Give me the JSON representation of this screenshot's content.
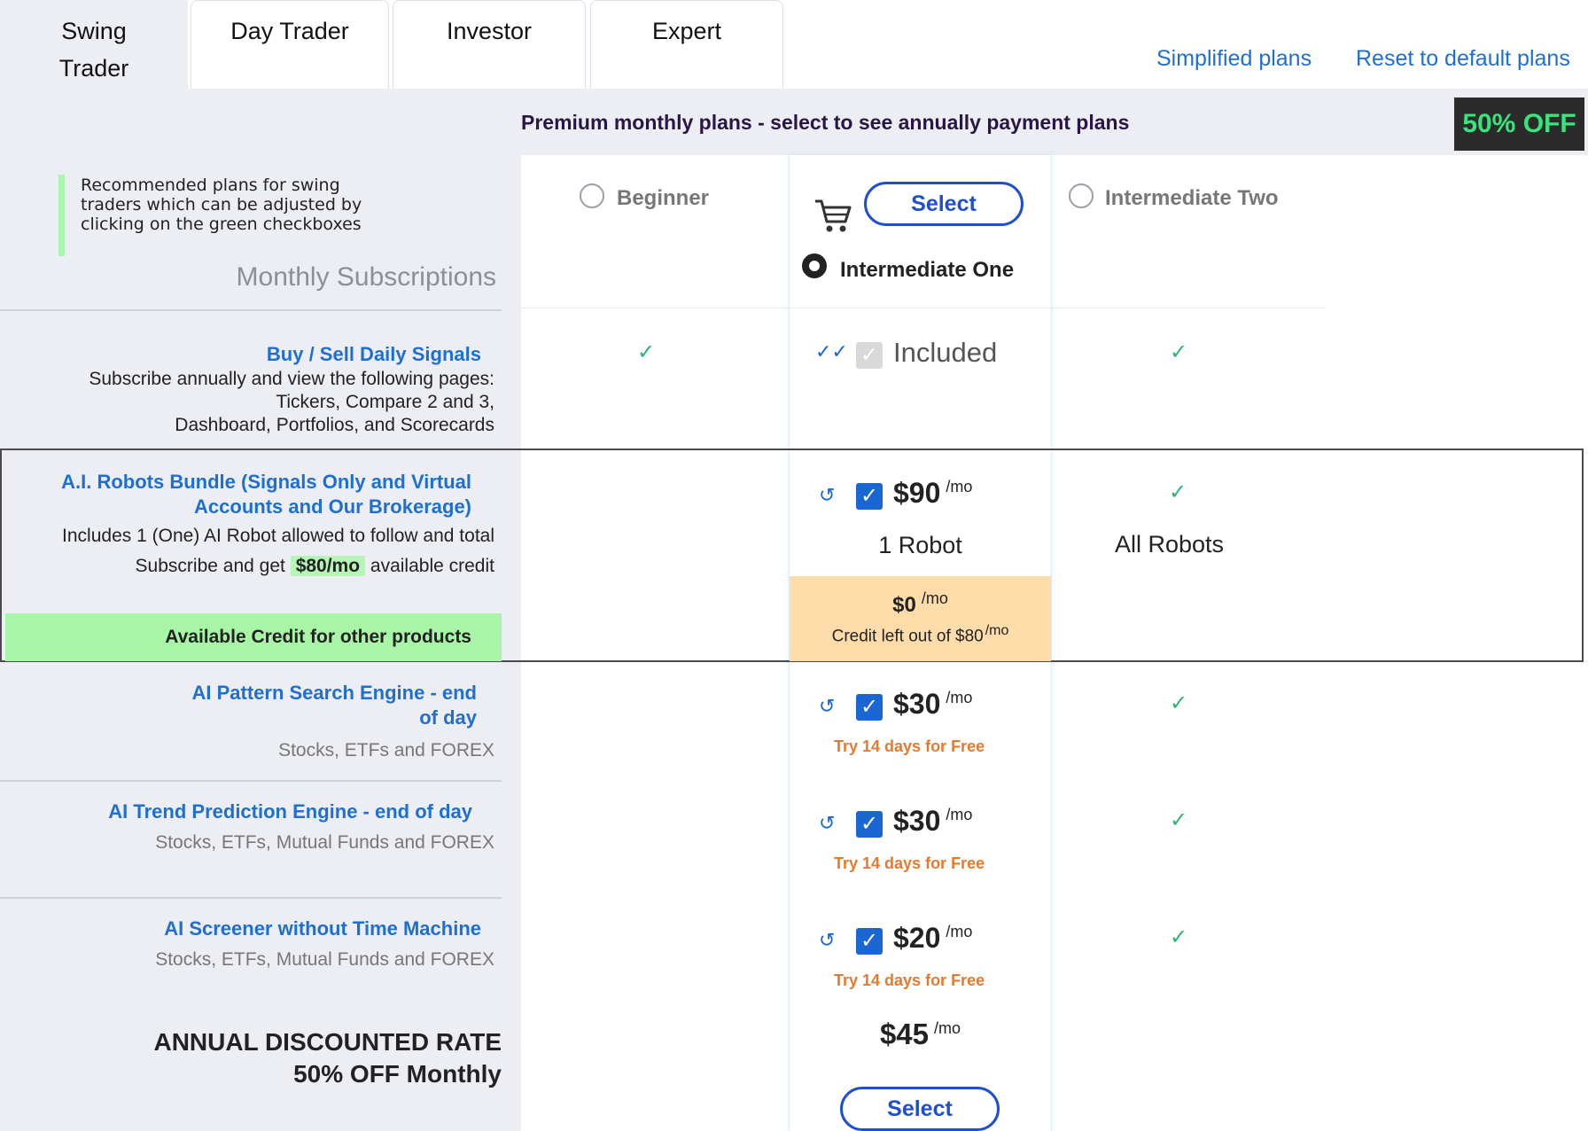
{
  "tabs": [
    {
      "label_line1": "Swing",
      "label_line2": "Trader"
    },
    {
      "label": "Day Trader"
    },
    {
      "label": "Investor"
    },
    {
      "label": "Expert"
    }
  ],
  "top_links": {
    "simplified": "Simplified plans",
    "reset": "Reset to default plans"
  },
  "header": {
    "premium_text": "Premium monthly plans - select to see annually payment plans",
    "badge": "50% OFF"
  },
  "recommend": {
    "line1": "Recommended plans for swing",
    "line2": "traders which can be adjusted by",
    "line3": "clicking on the green checkboxes",
    "monthly_title": "Monthly Subscriptions"
  },
  "plans": {
    "beginner": "Beginner",
    "intermediate_one": "Intermediate One",
    "intermediate_two": "Intermediate Two",
    "select_label": "Select"
  },
  "rows": {
    "signals": {
      "title": "Buy / Sell Daily Signals",
      "sub1": "Subscribe annually and view the following pages:",
      "sub2": "Tickers, Compare 2 and 3,",
      "sub3": "Dashboard, Portfolios, and Scorecards",
      "included": "Included"
    },
    "robots": {
      "title1": "A.I. Robots Bundle (Signals Only and Virtual",
      "title2": "Accounts and Our Brokerage)",
      "sub1": "Includes 1 (One) AI Robot allowed to follow and total",
      "sub2_pre": "Subscribe and get",
      "sub2_credit": "$80/mo",
      "sub2_post": "available credit",
      "price": "$90",
      "per": "/mo",
      "one_robot": "1 Robot",
      "all_robots": "All Robots",
      "credit_band": "Available Credit for other products",
      "credit_left_price": "$0",
      "credit_left_text": "Credit left out of $80"
    },
    "pattern": {
      "title1": "AI Pattern Search Engine - end",
      "title2": "of day",
      "sub": "Stocks, ETFs and FOREX",
      "price": "$30",
      "try": "Try 14 days for Free"
    },
    "trend": {
      "title": "AI Trend Prediction Engine - end of day",
      "sub": "Stocks, ETFs, Mutual Funds and FOREX",
      "price": "$30",
      "try": "Try 14 days for Free"
    },
    "screener": {
      "title": "AI Screener  without Time Machine",
      "sub": "Stocks, ETFs, Mutual Funds and FOREX",
      "price": "$20",
      "try": "Try 14 days for Free"
    }
  },
  "annual": {
    "line1": "ANNUAL DISCOUNTED RATE",
    "line2": "50% OFF Monthly",
    "total": "$45",
    "per": "/mo"
  },
  "colors": {
    "accent": "#1f6fd1",
    "check": "#2bb673",
    "badge_text": "#3be37c",
    "try": "#e9792a"
  }
}
